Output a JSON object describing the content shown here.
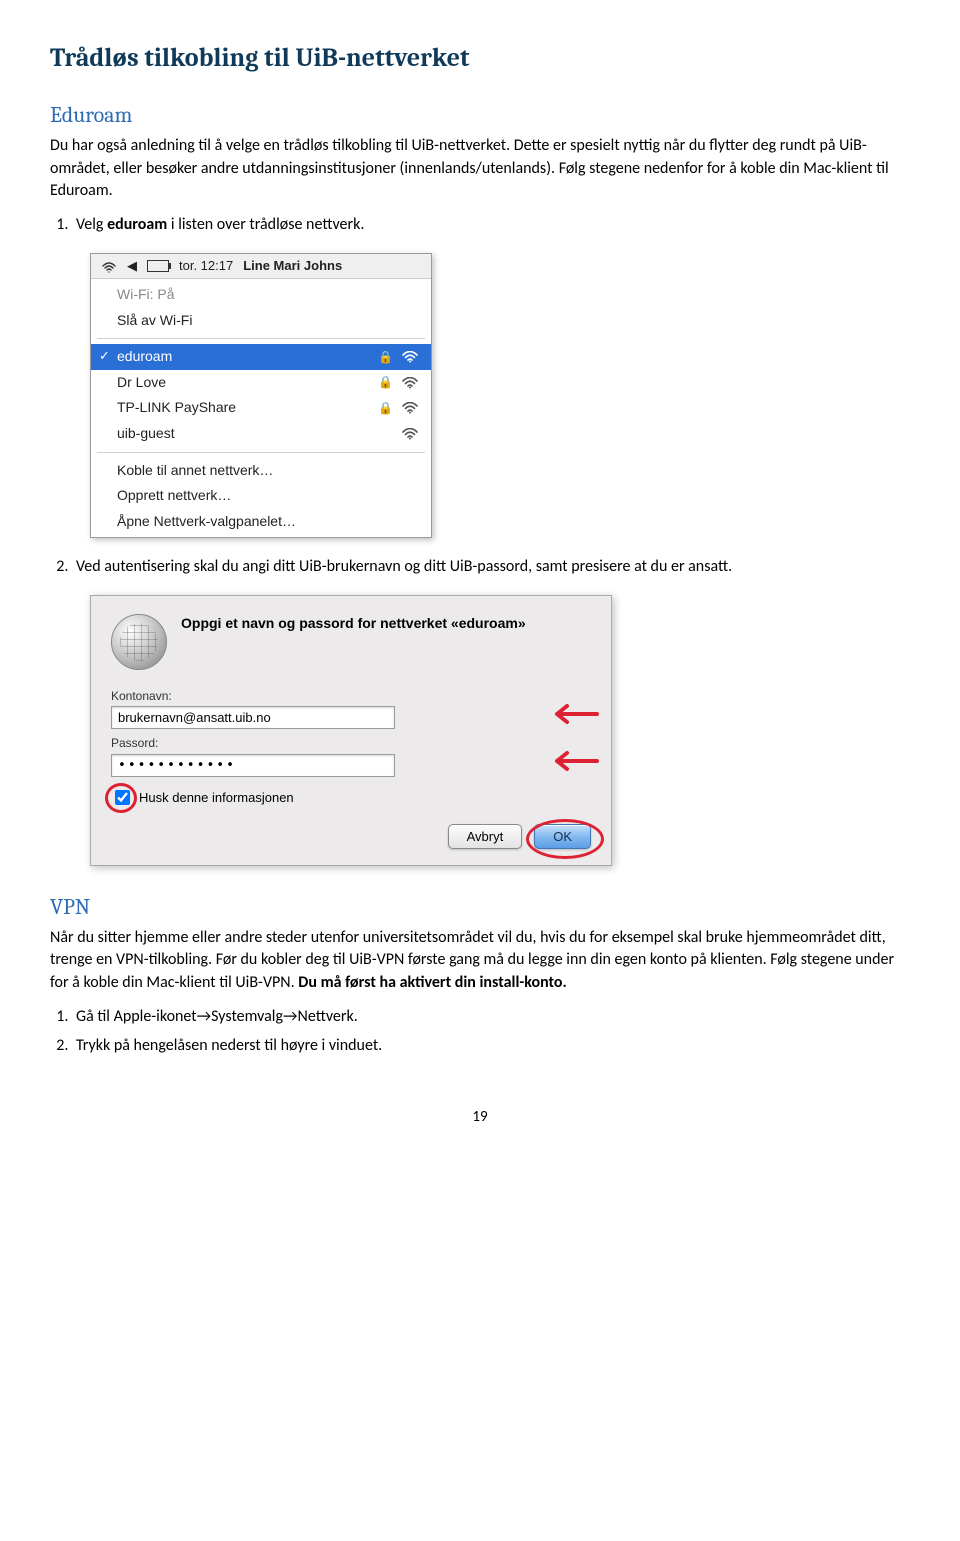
{
  "title": "Trådløs tilkobling til UiB-nettverket",
  "eduroam": {
    "heading": "Eduroam",
    "intro": "Du har også anledning til å velge en trådløs tilkobling til UiB-nettverket. Dette er spesielt nyttig når du flytter deg rundt på UiB-området, eller besøker andre utdanningsinstitusjoner (innenlands/utenlands). Følg stegene nedenfor for å koble din Mac-klient til Eduroam.",
    "step1_pre": "Velg ",
    "step1_bold": "eduroam",
    "step1_post": " i listen over trådløse nettverk.",
    "step2": "Ved autentisering skal du angi ditt UiB-brukernavn og ditt UiB-passord, samt presisere at du er ansatt."
  },
  "wifi_menu": {
    "menubar_time": "tor. 12:17",
    "menubar_user": "Line Mari Johns",
    "status": "Wi-Fi: På",
    "turn_off": "Slå av Wi-Fi",
    "networks": [
      {
        "name": "eduroam",
        "locked": true,
        "selected": true
      },
      {
        "name": "Dr Love",
        "locked": true,
        "selected": false
      },
      {
        "name": "TP-LINK PayShare",
        "locked": true,
        "selected": false
      },
      {
        "name": "uib-guest",
        "locked": false,
        "selected": false
      }
    ],
    "other": "Koble til annet nettverk…",
    "create": "Opprett nettverk…",
    "open_panel": "Åpne Nettverk-valgpanelet…"
  },
  "auth": {
    "title": "Oppgi et navn og passord for nettverket «eduroam»",
    "account_label": "Kontonavn:",
    "account_value": "brukernavn@ansatt.uib.no",
    "password_label": "Passord:",
    "password_value": "••••••••••••",
    "remember": "Husk denne informasjonen",
    "cancel": "Avbryt",
    "ok": "OK"
  },
  "vpn": {
    "heading": "VPN",
    "body_a": "Når du sitter hjemme eller andre steder utenfor universitetsområdet vil du, hvis du for eksempel skal bruke hjemmeområdet ditt, trenge en VPN-tilkobling. Før du kobler deg til UiB-VPN første gang må du legge inn din egen konto på klienten. Følg stegene under for å koble din Mac-klient til UiB-VPN. ",
    "body_bold": "Du må først ha aktivert din install-konto.",
    "step1": "Gå til Apple-ikonet→Systemvalg→Nettverk.",
    "step2": "Trykk på hengelåsen nederst til høyre i vinduet."
  },
  "page_number": "19"
}
